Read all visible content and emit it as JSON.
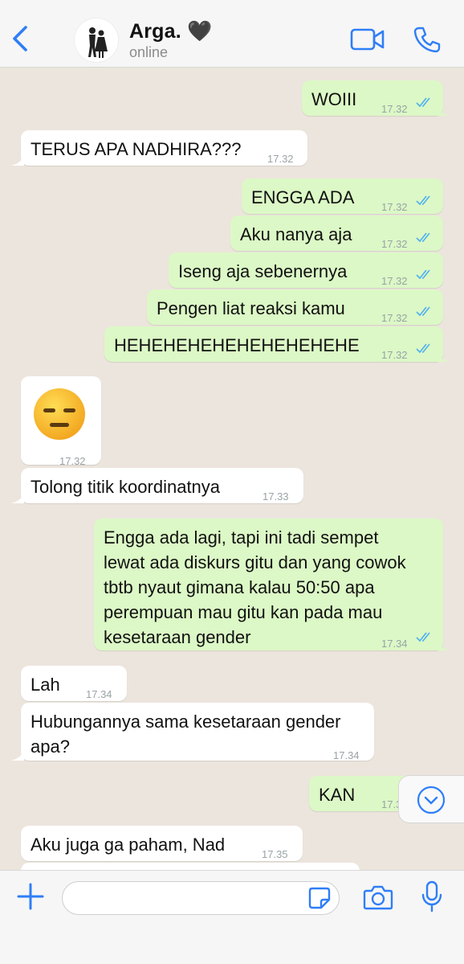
{
  "theme": {
    "accent": "#2f7ef7",
    "outgoing_bubble": "#dcf8c6",
    "incoming_bubble": "#ffffff",
    "chat_background": "#ece5dd",
    "read_ticks": "#4fb0f0"
  },
  "header": {
    "contact_name": "Arga. 🖤",
    "status": "online"
  },
  "messages": [
    {
      "dir": "out",
      "text": "WOIII",
      "time": "17.32",
      "read": true
    },
    {
      "dir": "in",
      "text": "TERUS APA NADHIRA???",
      "time": "17.32"
    },
    {
      "dir": "out",
      "text": "ENGGA ADA",
      "time": "17.32",
      "read": true
    },
    {
      "dir": "out",
      "text": "Aku nanya aja",
      "time": "17.32",
      "read": true
    },
    {
      "dir": "out",
      "text": "Iseng aja sebenernya",
      "time": "17.32",
      "read": true
    },
    {
      "dir": "out",
      "text": "Pengen liat reaksi kamu",
      "time": "17.32",
      "read": true
    },
    {
      "dir": "out",
      "text": "HEHEHEHEHEHEHEHEHEHE",
      "time": "17.32",
      "read": true
    },
    {
      "dir": "in",
      "emoji": "expressionless-face",
      "time": "17.32"
    },
    {
      "dir": "in",
      "text": "Tolong titik koordinatnya",
      "time": "17.33"
    },
    {
      "dir": "out",
      "text": "Engga ada lagi, tapi ini tadi sempet\nlewat ada diskurs gitu dan yang cowok\ntbtb nyaut gimana kalau 50:50 apa\nperempuan mau gitu kan pada mau\nkesetaraan gender",
      "time": "17.34",
      "read": true
    },
    {
      "dir": "in",
      "text": "Lah",
      "time": "17.34"
    },
    {
      "dir": "in",
      "text": "Hubungannya sama kesetaraan gender\napa?",
      "time": "17.34"
    },
    {
      "dir": "out",
      "text": "KAN",
      "time": "17.35",
      "read": true
    },
    {
      "dir": "in",
      "text": "Aku juga ga paham, Nad",
      "time": "17.35"
    }
  ],
  "input": {
    "placeholder": ""
  },
  "icons": [
    "back-icon",
    "avatar",
    "video-call-icon",
    "phone-icon",
    "double-check-icon",
    "chevron-down-icon",
    "plus-icon",
    "sticker-icon",
    "camera-icon",
    "microphone-icon"
  ]
}
